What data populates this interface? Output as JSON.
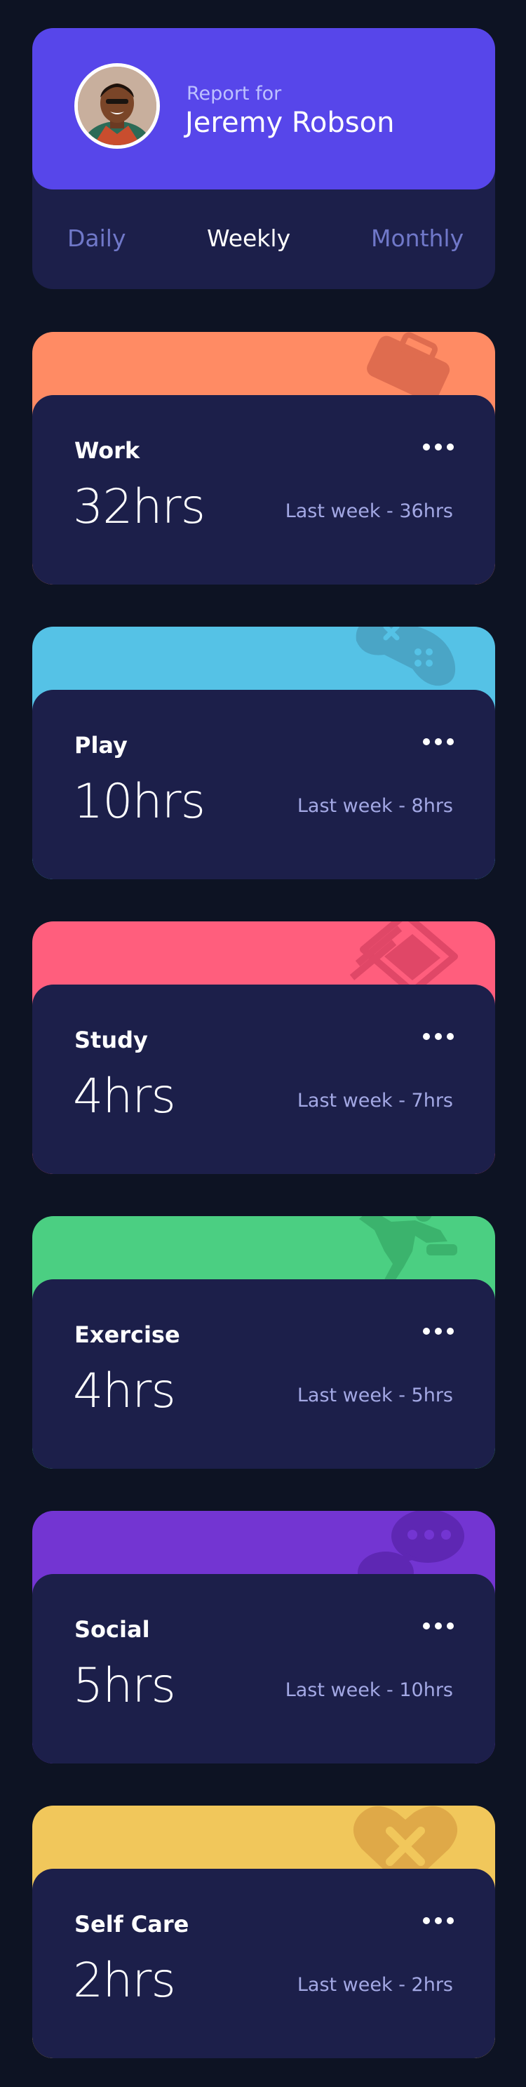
{
  "profile": {
    "report_for": "Report for",
    "name": "Jeremy Robson",
    "accent": "#5746ea"
  },
  "tabs": [
    {
      "label": "Daily",
      "active": false
    },
    {
      "label": "Weekly",
      "active": true
    },
    {
      "label": "Monthly",
      "active": false
    }
  ],
  "cards": [
    {
      "title": "Work",
      "hours": "32hrs",
      "previous": "Last week - 36hrs",
      "color": "#ff8b64",
      "icon": "briefcase-icon"
    },
    {
      "title": "Play",
      "hours": "10hrs",
      "previous": "Last week - 8hrs",
      "color": "#55c2e6",
      "icon": "gamepad-icon"
    },
    {
      "title": "Study",
      "hours": "4hrs",
      "previous": "Last week - 7hrs",
      "color": "#ff5e7d",
      "icon": "book-icon"
    },
    {
      "title": "Exercise",
      "hours": "4hrs",
      "previous": "Last week - 5hrs",
      "color": "#4bcf82",
      "icon": "running-icon"
    },
    {
      "title": "Social",
      "hours": "5hrs",
      "previous": "Last week - 10hrs",
      "color": "#7335d2",
      "icon": "chat-icon"
    },
    {
      "title": "Self Care",
      "hours": "2hrs",
      "previous": "Last week - 2hrs",
      "color": "#f1c75b",
      "icon": "heart-icon"
    }
  ]
}
